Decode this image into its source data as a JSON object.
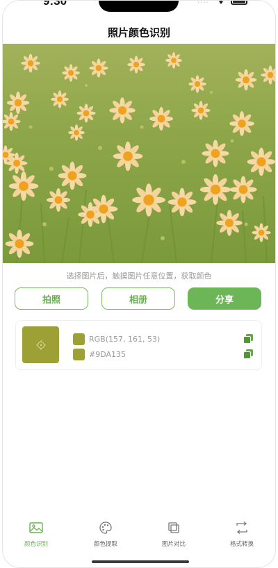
{
  "status_bar": {
    "time": "9:30"
  },
  "nav": {
    "title": "照片颜色识别"
  },
  "hint": "选择图片后，触摸图片任意位置，获取颜色",
  "buttons": {
    "camera": "拍照",
    "album": "相册",
    "share": "分享"
  },
  "color_result": {
    "swatch_color": "#9DA135",
    "rgb_text": "RGB(157, 161, 53)",
    "hex_text": "#9DA135"
  },
  "tabs": [
    {
      "label": "颜色识别",
      "icon": "image-icon",
      "active": true
    },
    {
      "label": "颜色提取",
      "icon": "palette-icon",
      "active": false
    },
    {
      "label": "图片对比",
      "icon": "compare-icon",
      "active": false
    },
    {
      "label": "格式转换",
      "icon": "convert-icon",
      "active": false
    }
  ],
  "colors": {
    "accent": "#6DB658",
    "tab_active": "#6AAF52"
  }
}
